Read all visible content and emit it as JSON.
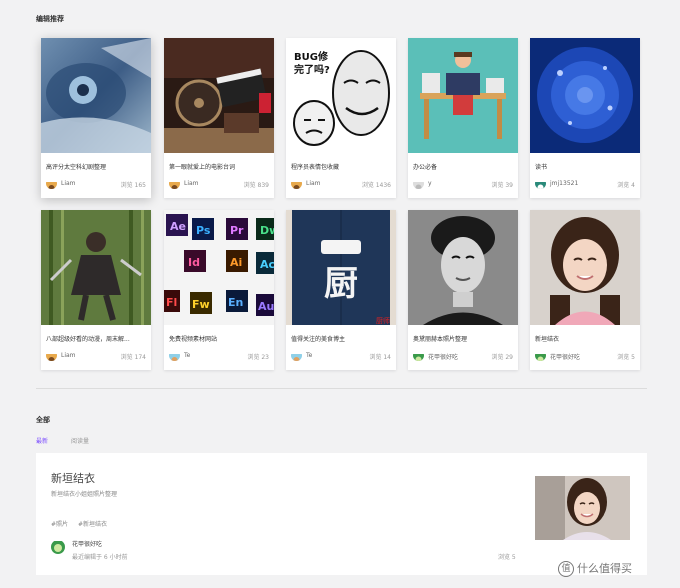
{
  "section_editor": {
    "title": "编辑推荐"
  },
  "cards": [
    {
      "title": "高评分太空科幻剧整理",
      "author": "Liam",
      "views": "浏览 165"
    },
    {
      "title": "第一眼就爱上的电影台词",
      "author": "Liam",
      "views": "浏览 839"
    },
    {
      "title": "程序员表情包收藏",
      "author": "Liam",
      "views": "浏览 1436"
    },
    {
      "title": "办公必备",
      "author": "y",
      "views": "浏览 39"
    },
    {
      "title": "读书",
      "author": "jmj13521",
      "views": "浏览 4"
    },
    {
      "title": "八部超级好看的动漫，周末解...",
      "author": "Liam",
      "views": "浏览 174"
    },
    {
      "title": "免费视频素材网站",
      "author": "Te",
      "views": "浏览 23"
    },
    {
      "title": "值得关注的美食博主",
      "author": "Te",
      "views": "浏览 14"
    },
    {
      "title": "奥黛丽赫本照片整理",
      "author": "花甲很好吃",
      "views": "浏览 29"
    },
    {
      "title": "新垣结衣",
      "author": "花甲很好吃",
      "views": "浏览 5"
    }
  ],
  "thumb_text": {
    "bug": "BUG修\n完了吗?",
    "kitchen": "厨",
    "stamp": "厨师"
  },
  "section_all": {
    "title": "全部",
    "tabs": [
      {
        "label": "最新",
        "active": true
      },
      {
        "label": "阅读量",
        "active": false
      }
    ]
  },
  "list_item": {
    "title": "新垣结衣",
    "subtitle": "新垣结衣小姐姐照片整理",
    "tags": [
      "#照片",
      "#新垣结衣"
    ],
    "author": "花甲很好吃",
    "edited": "最近编辑于 6 小时前",
    "views": "浏览 5"
  },
  "watermark": {
    "icon": "值",
    "text": "什么值得买"
  },
  "colors": {
    "accent": "#7c4dff",
    "background": "#f2f2f3"
  }
}
